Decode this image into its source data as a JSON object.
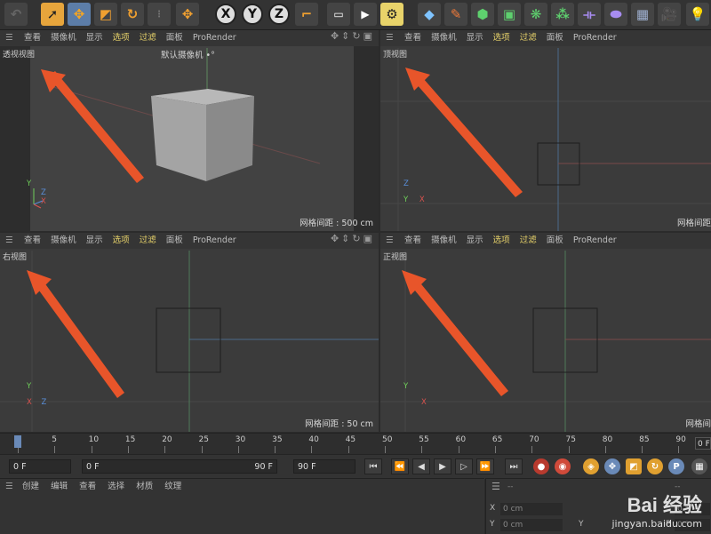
{
  "toolbar": {
    "axis_x": "X",
    "axis_y": "Y",
    "axis_z": "Z",
    "icons": [
      "undo-icon",
      "select-arrow-icon",
      "move-icon",
      "scale-icon",
      "rotate-icon",
      "recent-tools-icon",
      "move-small-icon",
      "x-lock-icon",
      "y-lock-icon",
      "z-lock-icon",
      "world-coords-icon",
      "render-region-icon",
      "render-view-icon",
      "render-settings-icon",
      "cube-icon",
      "pen-icon",
      "subdivision-icon",
      "nurbs-icon",
      "mograph-icon",
      "array-icon",
      "deformer-icon",
      "environment-icon",
      "floor-icon",
      "camera-icon",
      "light-icon"
    ]
  },
  "viewport_menu": {
    "items": [
      "查看",
      "摄像机",
      "显示",
      "选项",
      "过滤",
      "面板",
      "ProRender"
    ],
    "highlighted": [
      "选项",
      "过滤"
    ]
  },
  "viewports": {
    "perspective": {
      "title": "透视视图",
      "camera": "默认摄像机",
      "camera_icon": "•°",
      "grid": "网格间距 : 500 cm"
    },
    "top": {
      "title": "顶视图",
      "grid": "网格间距"
    },
    "right": {
      "title": "右视图",
      "grid": "网格间距 : 50 cm"
    },
    "front": {
      "title": "正视图",
      "grid": "网格间"
    }
  },
  "axes": {
    "x": "X",
    "y": "Y",
    "z": "Z"
  },
  "timeline": {
    "ticks": [
      "0",
      "5",
      "10",
      "15",
      "20",
      "25",
      "30",
      "35",
      "40",
      "45",
      "50",
      "55",
      "60",
      "65",
      "70",
      "75",
      "80",
      "85",
      "90"
    ],
    "end_field": "0 F"
  },
  "transport": {
    "current_frame": "0 F",
    "range_start": "0 F",
    "range_end": "90 F",
    "max_frame": "90 F"
  },
  "material_panel": {
    "menu": [
      "创建",
      "编辑",
      "查看",
      "选择",
      "材质",
      "纹理"
    ]
  },
  "attr_panel": {
    "header": "--",
    "header_right": "--",
    "rows": [
      {
        "axis": "X",
        "value": "0 cm",
        "right": "0 °"
      },
      {
        "axis": "Y",
        "value": "0 cm",
        "mid": "Y",
        "right_label": "P",
        "right": "0 °"
      }
    ]
  },
  "watermark": {
    "brand": "Bai 经验",
    "url": "jingyan.baidu.com"
  },
  "colors": {
    "arrow": "#e8552a",
    "highlight": "#e8d36a",
    "axis_x": "#d9534f",
    "axis_y": "#6fcf5a",
    "axis_z": "#5a8fd9",
    "selected_button": "#5c7da8"
  }
}
